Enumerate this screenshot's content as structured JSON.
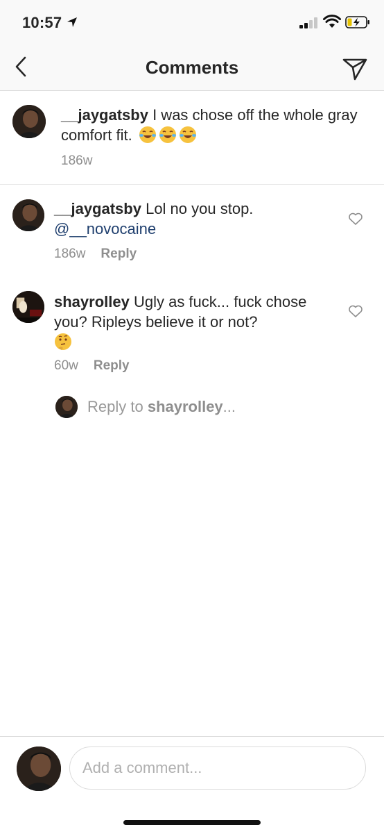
{
  "status_bar": {
    "time": "10:57"
  },
  "header": {
    "title": "Comments"
  },
  "caption": {
    "username": "__jaygatsby",
    "text": " I was chose off the whole gray comfort fit.",
    "emoji": "face-with-tears-of-joy ×3",
    "timestamp": "186w"
  },
  "comments": [
    {
      "username": "__jaygatsby",
      "text": " Lol no you stop.",
      "mention": "@__novocaine",
      "timestamp": "186w",
      "reply_label": "Reply"
    },
    {
      "username": "shayrolley",
      "text": " Ugly as fuck... fuck chose you? Ripleys believe it or not?",
      "emoji": "thinking-face",
      "timestamp": "60w",
      "reply_label": "Reply"
    }
  ],
  "reply_prompt": {
    "prefix": "Reply to ",
    "username": "shayrolley",
    "suffix": "..."
  },
  "composer": {
    "placeholder": "Add a comment..."
  },
  "colors": {
    "mention": "#1f3f6e",
    "meta": "#8e8e8e",
    "divider": "#dbdbdb"
  }
}
